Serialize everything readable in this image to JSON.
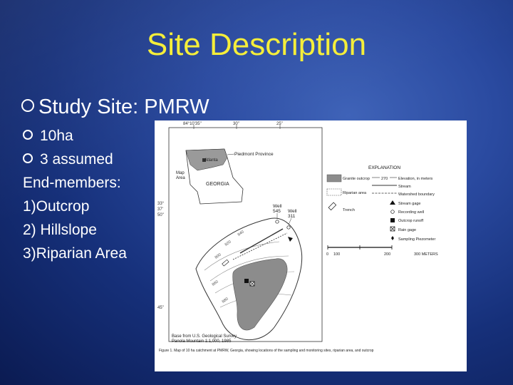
{
  "slide": {
    "title": "Site Description",
    "main_bullet": "Study Site: PMRW",
    "sub_bullets": [
      "10ha",
      "3 assumed"
    ],
    "lines": [
      "End-members:",
      "1)Outcrop",
      "2) Hillslope",
      "3)Riparian Area"
    ]
  },
  "figure": {
    "coords_top": [
      "84°10'35\"",
      "30\"",
      "25\""
    ],
    "coords_left": [
      "33°",
      "37'",
      "50\"",
      "45\""
    ],
    "inset": {
      "piedmont": "Piedmont Province",
      "atlanta": "Atlanta",
      "map_area_1": "Map",
      "map_area_2": "Area",
      "state": "GEORGIA"
    },
    "well_labels": {
      "w1a": "Well",
      "w1b": "545",
      "w2a": "Well",
      "w2b": "311"
    },
    "elevations": [
      "800",
      "820",
      "840",
      "860",
      "880"
    ],
    "explanation": {
      "heading": "EXPLANATION",
      "granite": "Granite outcrop",
      "riparian": "Riparian area",
      "trench": "Trench",
      "contour_value": "270",
      "elevation": "Elevation, in meters",
      "stream": "Stream",
      "watershed": "Watershed boundary",
      "stream_gage": "Stream gage",
      "recording_well": "Recording well",
      "outcrop_runoff": "Outcrop runoff",
      "rain_gage": "Rain gage",
      "piezometer": "Sampling Piezometer"
    },
    "scale": {
      "s0": "0",
      "s1": "100",
      "s2": "200",
      "s3": "300 METERS"
    },
    "base_1": "Base from U.S. Geological Survey",
    "base_2": "Panola Mountain 1:1,000, 1985",
    "caption": "Figure 1. Map of 10 ha catchment at PMRW, Georgia, showing locations of the sampling and monitoring sites, riparian area, and outcrop"
  },
  "colors": {
    "title": "#f5ee3a",
    "text": "#ffffff",
    "granite_fill": "#8c8c8c"
  }
}
